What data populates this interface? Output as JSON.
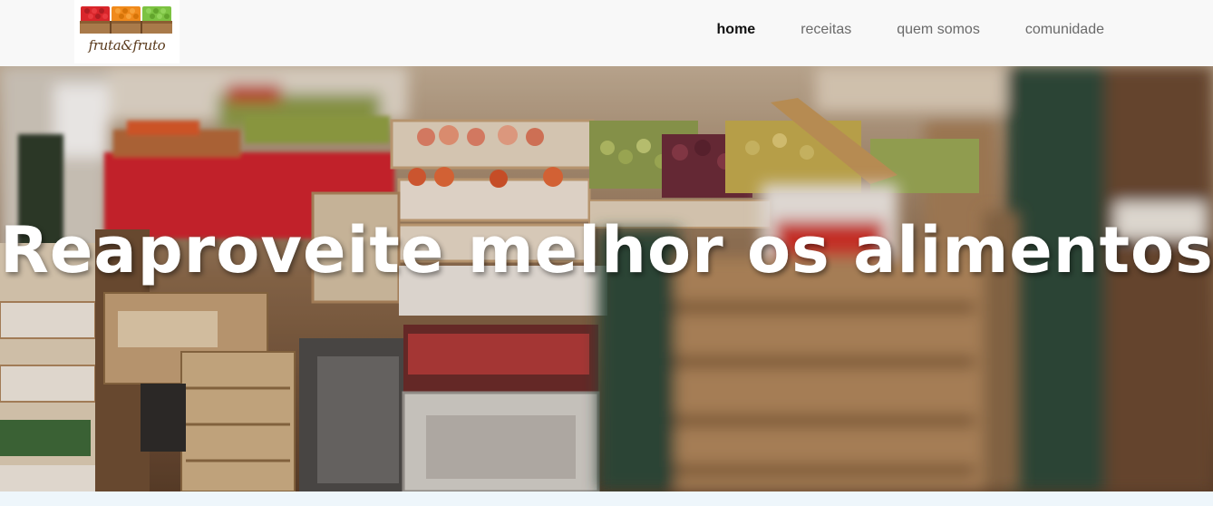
{
  "navbar": {
    "logo_text": "fruta&fruto",
    "items": [
      {
        "label": "home",
        "active": true
      },
      {
        "label": "receitas",
        "active": false
      },
      {
        "label": "quem somos",
        "active": false
      },
      {
        "label": "comunidade",
        "active": false
      }
    ]
  },
  "hero": {
    "title": "Reaproveite melhor os alimentos!"
  },
  "colors": {
    "navbar_bg": "#f8f8f8",
    "active_link": "#111111",
    "inactive_link": "#6a6a6a",
    "hero_text": "#ffffff",
    "crate_red": "#d9262b",
    "crate_orange": "#f08a1c",
    "crate_green": "#7cc242"
  }
}
